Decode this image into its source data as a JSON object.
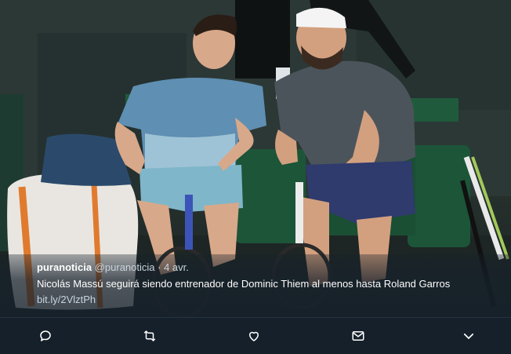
{
  "tweet": {
    "author_name": "puranoticia",
    "author_handle": "@puranoticia",
    "separator": "·",
    "date": "4 avr.",
    "text": "Nicolás Massú seguirá siendo entrenador de Dominic Thiem al menos hasta Roland Garros",
    "link": "bit.ly/2VlztPh"
  },
  "actions": [
    {
      "icon": "reply-icon"
    },
    {
      "icon": "retweet-icon"
    },
    {
      "icon": "like-icon"
    },
    {
      "icon": "direct-message-icon"
    },
    {
      "icon": "chevron-down-icon"
    }
  ],
  "colors": {
    "background": "#15202b",
    "caption_text": "#ffffff",
    "secondary_text": "#c9d4de",
    "icon": "#ffffff"
  }
}
